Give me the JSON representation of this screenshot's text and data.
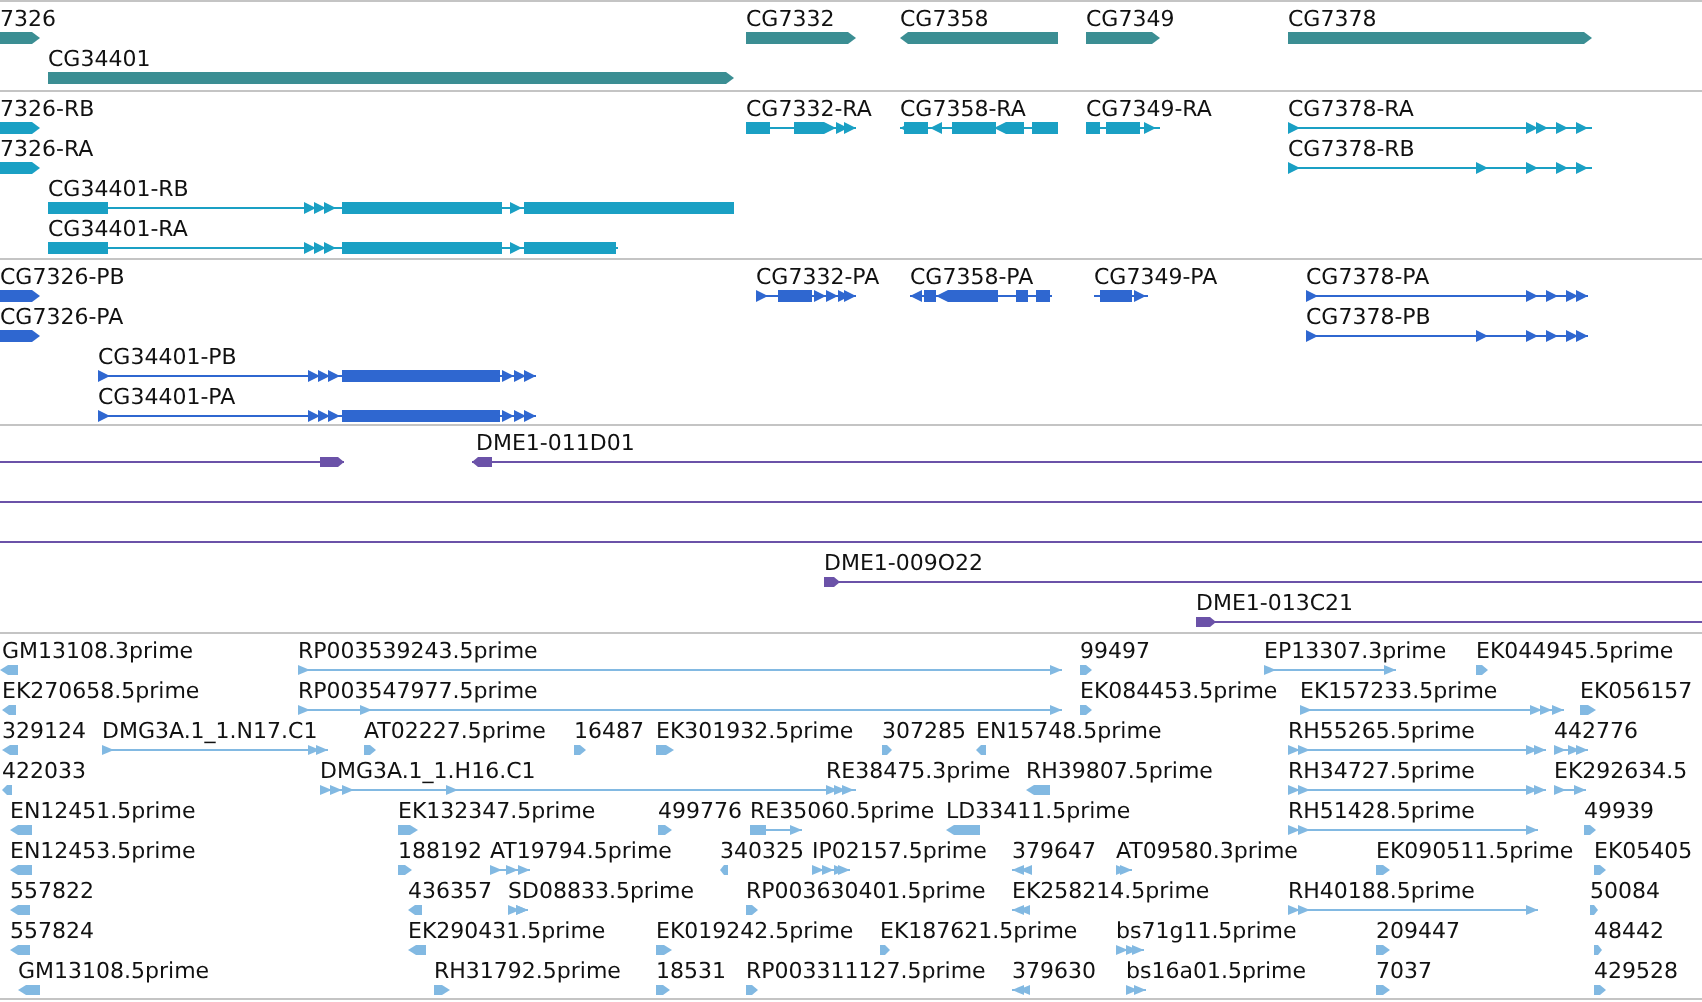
{
  "tracks": [
    {
      "kind": "gene",
      "features": [
        {
          "label": "7326",
          "reverse": false
        },
        {
          "label": "CG34401",
          "reverse": false
        },
        {
          "label": "CG7332",
          "reverse": false
        },
        {
          "label": "CG7358",
          "reverse": true
        },
        {
          "label": "CG7349",
          "reverse": false
        },
        {
          "label": "CG7378",
          "reverse": false
        }
      ]
    },
    {
      "kind": "mrna",
      "features": [
        {
          "label": "7326-RB",
          "reverse": false
        },
        {
          "label": "7326-RA",
          "reverse": false
        },
        {
          "label": "CG34401-RB",
          "reverse": false
        },
        {
          "label": "CG34401-RA",
          "reverse": false
        },
        {
          "label": "CG7332-RA",
          "reverse": false
        },
        {
          "label": "CG7358-RA",
          "reverse": true
        },
        {
          "label": "CG7349-RA",
          "reverse": false
        },
        {
          "label": "CG7378-RA",
          "reverse": false
        },
        {
          "label": "CG7378-RB",
          "reverse": false
        }
      ]
    },
    {
      "kind": "cds",
      "features": [
        {
          "label": "CG7326-PB",
          "reverse": false
        },
        {
          "label": "CG7326-PA",
          "reverse": false
        },
        {
          "label": "CG34401-PB",
          "reverse": false
        },
        {
          "label": "CG34401-PA",
          "reverse": false
        },
        {
          "label": "CG7332-PA",
          "reverse": false
        },
        {
          "label": "CG7358-PA",
          "reverse": true
        },
        {
          "label": "CG7349-PA",
          "reverse": false
        },
        {
          "label": "CG7378-PA",
          "reverse": false
        },
        {
          "label": "CG7378-PB",
          "reverse": false
        }
      ]
    },
    {
      "kind": "clone",
      "features": [
        {
          "kind": "arrow",
          "reverse": false
        },
        {
          "kind": "arrow",
          "label": "DME1-011D01",
          "reverse": true
        },
        {
          "kind": "line"
        },
        {
          "kind": "line"
        },
        {
          "kind": "arrow",
          "label": "DME1-009O22",
          "reverse": false
        },
        {
          "kind": "arrow",
          "label": "DME1-013C21",
          "reverse": false
        }
      ]
    },
    {
      "kind": "est",
      "features": [
        {
          "label": "GM13108.3prime",
          "reverse": true
        },
        {
          "label": "RP003539243.5prime",
          "reverse": false
        },
        {
          "label": "99497",
          "reverse": false
        },
        {
          "label": "EP13307.3prime",
          "reverse": false
        },
        {
          "label": "EK044945.5prime",
          "reverse": false
        },
        {
          "label": "EK270658.5prime",
          "reverse": true
        },
        {
          "label": "RP003547977.5prime",
          "reverse": false
        },
        {
          "label": "EK084453.5prime",
          "reverse": false
        },
        {
          "label": "EK157233.5prime",
          "reverse": false
        },
        {
          "label": "EK056157",
          "reverse": false
        },
        {
          "label": "329124",
          "reverse": true
        },
        {
          "label": "DMG3A.1_1.N17.C1",
          "reverse": false
        },
        {
          "label": "AT02227.5prime",
          "reverse": false
        },
        {
          "label": "16487",
          "reverse": false
        },
        {
          "label": "EK301932.5prime",
          "reverse": false
        },
        {
          "label": "307285",
          "reverse": false
        },
        {
          "label": "EN15748.5prime",
          "reverse": true
        },
        {
          "label": "RH55265.5prime",
          "reverse": false
        },
        {
          "label": "442776",
          "reverse": false
        },
        {
          "label": "422033",
          "reverse": true
        },
        {
          "label": "DMG3A.1_1.H16.C1",
          "reverse": false
        },
        {
          "label": "RE38475.3prime",
          "reverse": false
        },
        {
          "label": "RH39807.5prime",
          "reverse": true
        },
        {
          "label": "RH34727.5prime",
          "reverse": false
        },
        {
          "label": "EK292634.5",
          "reverse": false
        },
        {
          "label": "EN12451.5prime",
          "reverse": true
        },
        {
          "label": "EK132347.5prime",
          "reverse": false
        },
        {
          "label": "499776",
          "reverse": false
        },
        {
          "label": "RE35060.5prime",
          "reverse": false
        },
        {
          "label": "LD33411.5prime",
          "reverse": true
        },
        {
          "label": "RH51428.5prime",
          "reverse": false
        },
        {
          "label": "49939",
          "reverse": false
        },
        {
          "label": "EN12453.5prime",
          "reverse": true
        },
        {
          "label": "188192",
          "reverse": false
        },
        {
          "label": "AT19794.5prime",
          "reverse": false
        },
        {
          "label": "340325",
          "reverse": true
        },
        {
          "label": "IP02157.5prime",
          "reverse": false
        },
        {
          "label": "379647",
          "reverse": true
        },
        {
          "label": "AT09580.3prime",
          "reverse": false
        },
        {
          "label": "EK090511.5prime",
          "reverse": false
        },
        {
          "label": "EK05405",
          "reverse": false
        },
        {
          "label": "557822",
          "reverse": true
        },
        {
          "label": "436357",
          "reverse": true
        },
        {
          "label": "SD08833.5prime",
          "reverse": false
        },
        {
          "label": "RP003630401.5prime",
          "reverse": false
        },
        {
          "label": "EK258214.5prime",
          "reverse": true
        },
        {
          "label": "RH40188.5prime",
          "reverse": false
        },
        {
          "label": "50084",
          "reverse": false
        },
        {
          "label": "557824",
          "reverse": true
        },
        {
          "label": "EK290431.5prime",
          "reverse": true
        },
        {
          "label": "EK019242.5prime",
          "reverse": false
        },
        {
          "label": "EK187621.5prime",
          "reverse": false
        },
        {
          "label": "bs71g11.5prime",
          "reverse": false
        },
        {
          "label": "209447",
          "reverse": false
        },
        {
          "label": "48442",
          "reverse": false
        },
        {
          "label": "GM13108.5prime",
          "reverse": true
        },
        {
          "label": "RH31792.5prime",
          "reverse": false
        },
        {
          "label": "18531",
          "reverse": false
        },
        {
          "label": "RP003311127.5prime",
          "reverse": false
        },
        {
          "label": "379630",
          "reverse": true
        },
        {
          "label": "bs16a01.5prime",
          "reverse": false
        },
        {
          "label": "7037",
          "reverse": false
        },
        {
          "label": "429528",
          "reverse": false
        }
      ]
    }
  ]
}
